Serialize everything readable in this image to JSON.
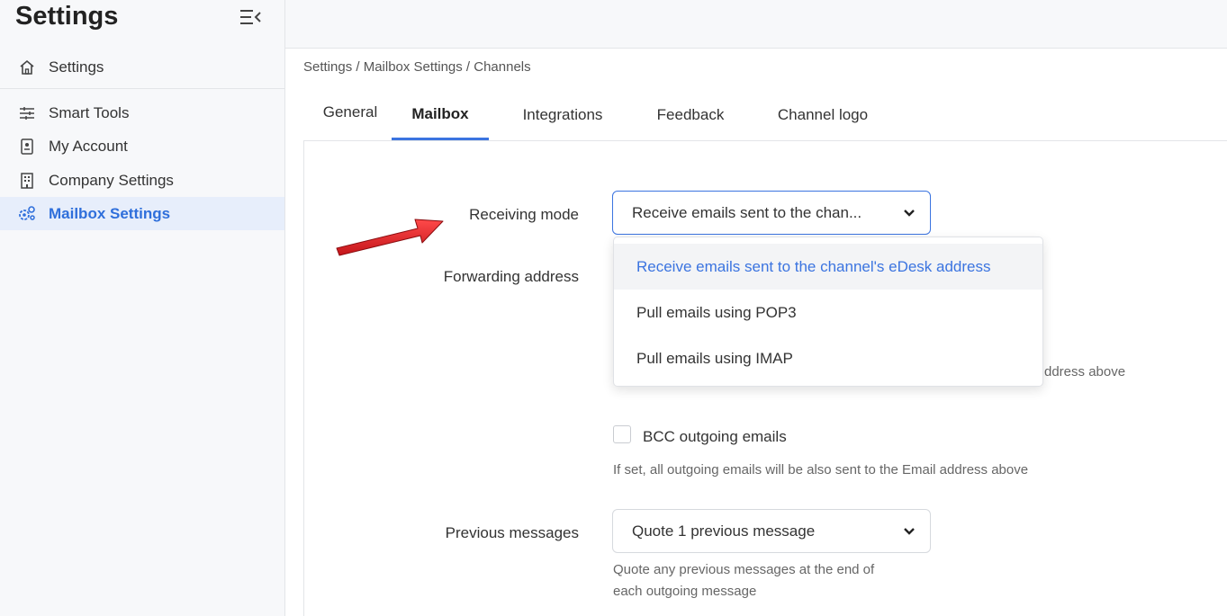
{
  "sidebar": {
    "title": "Settings",
    "items": [
      {
        "label": "Settings",
        "icon": "home-icon"
      },
      {
        "label": "Smart Tools",
        "icon": "sliders-icon"
      },
      {
        "label": "My Account",
        "icon": "badge-icon"
      },
      {
        "label": "Company Settings",
        "icon": "building-icon"
      },
      {
        "label": "Mailbox Settings",
        "icon": "gears-icon",
        "active": true
      }
    ]
  },
  "breadcrumb": "Settings / Mailbox Settings / Channels",
  "tabs": [
    {
      "label": "General"
    },
    {
      "label": "Mailbox",
      "active": true
    },
    {
      "label": "Integrations"
    },
    {
      "label": "Feedback"
    },
    {
      "label": "Channel logo"
    }
  ],
  "form": {
    "receiving_mode_label": "Receiving mode",
    "receiving_mode_value": "Receive emails sent to the chan...",
    "forwarding_address_label": "Forwarding address",
    "partial_help": "ddress above",
    "bcc_label": "BCC outgoing emails",
    "bcc_help": "If set, all outgoing emails will be also sent to the Email address above",
    "previous_messages_label": "Previous messages",
    "previous_messages_value": "Quote 1 previous message",
    "previous_help_line1": "Quote any previous messages at the end of",
    "previous_help_line2": "each outgoing message"
  },
  "dropdown": {
    "options": [
      {
        "label": "Receive emails sent to the channel's eDesk address",
        "selected": true
      },
      {
        "label": "Pull emails using POP3"
      },
      {
        "label": "Pull emails using IMAP"
      }
    ]
  },
  "colors": {
    "accent": "#3b74e0",
    "annotation_arrow": "#e0262b"
  }
}
